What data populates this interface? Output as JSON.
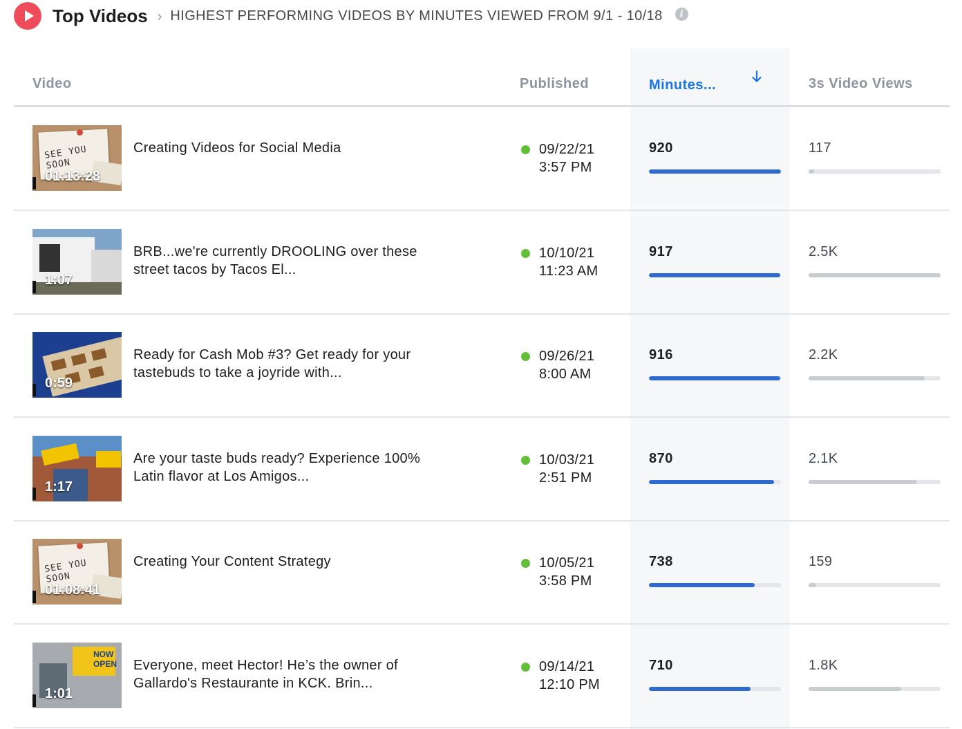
{
  "header": {
    "title": "Top Videos",
    "subtitle": "HIGHEST PERFORMING VIDEOS BY MINUTES VIEWED FROM 9/1 - 10/18",
    "info_icon": "info-icon",
    "play_icon": "play-icon",
    "accent_color": "#ee4c5b"
  },
  "columns": {
    "video": "Video",
    "published": "Published",
    "minutes": "Minutes...",
    "views": "3s Video Views",
    "sorted_column": "minutes",
    "sort_direction": "descending",
    "sorted_color": "#1b74e4"
  },
  "status_color": "#63be3a",
  "rows": [
    {
      "duration": "01:13:28",
      "title": "Creating Videos for Social Media",
      "date": "09/22/21",
      "time": "3:57 PM",
      "minutes": "920",
      "minutes_fraction": 1.0,
      "views": "117",
      "views_fraction": 0.04,
      "thumb": "cork",
      "thumb_text": "SEE YOU SOON"
    },
    {
      "duration": "1:07",
      "title": "BRB...we're currently DROOLING over these street tacos by Tacos El...",
      "date": "10/10/21",
      "time": "11:23 AM",
      "minutes": "917",
      "minutes_fraction": 0.997,
      "views": "2.5K",
      "views_fraction": 1.0,
      "thumb": "truck"
    },
    {
      "duration": "0:59",
      "title": "Ready for Cash Mob #3? Get ready for your tastebuds to take a joyride with...",
      "date": "09/26/21",
      "time": "8:00 AM",
      "minutes": "916",
      "minutes_fraction": 0.996,
      "views": "2.2K",
      "views_fraction": 0.88,
      "thumb": "sign"
    },
    {
      "duration": "1:17",
      "title": "Are your taste buds ready? Experience 100% Latin flavor at Los Amigos...",
      "date": "10/03/21",
      "time": "2:51 PM",
      "minutes": "870",
      "minutes_fraction": 0.946,
      "views": "2.1K",
      "views_fraction": 0.82,
      "thumb": "storefront"
    },
    {
      "duration": "01:08:41",
      "title": "Creating Your Content Strategy",
      "date": "10/05/21",
      "time": "3:58 PM",
      "minutes": "738",
      "minutes_fraction": 0.802,
      "views": "159",
      "views_fraction": 0.06,
      "thumb": "cork",
      "thumb_text": "SEE YOU SOON"
    },
    {
      "duration": "1:01",
      "title": "Everyone, meet Hector! He’s the owner of Gallardo's Restaurante in KCK. Brin...",
      "date": "09/14/21",
      "time": "12:10 PM",
      "minutes": "710",
      "minutes_fraction": 0.772,
      "views": "1.8K",
      "views_fraction": 0.7,
      "thumb": "building",
      "thumb_text": "NOW OPEN"
    }
  ]
}
